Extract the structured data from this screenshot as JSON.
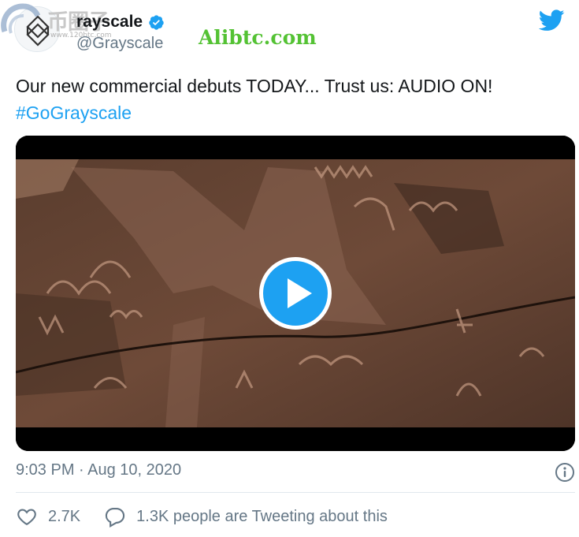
{
  "author": {
    "display_name": "Grayscale",
    "display_name_visible": "rayscale",
    "handle": "@Grayscale",
    "verified": true
  },
  "watermarks": {
    "site_cn": "币圈子",
    "site_url": "www.120btc.com",
    "alibtc": "Alibtc.com"
  },
  "tweet": {
    "text": "Our new commercial debuts TODAY... Trust us: AUDIO ON!",
    "hashtag": "#GoGrayscale"
  },
  "media": {
    "type": "video",
    "play_icon": "play-icon"
  },
  "meta": {
    "timestamp": "9:03 PM · Aug 10, 2020",
    "info_icon": "info-icon"
  },
  "stats": {
    "likes": "2.7K",
    "retweets_text": "1.3K people are Tweeting about this"
  },
  "colors": {
    "accent": "#1da1f2",
    "secondary_text": "#657786",
    "primary_text": "#14171a",
    "watermark_green": "#4bbf2a"
  },
  "icons": [
    "twitter-bird-icon",
    "verified-badge-icon",
    "heart-icon",
    "comment-bubble-icon",
    "info-icon",
    "play-icon"
  ]
}
